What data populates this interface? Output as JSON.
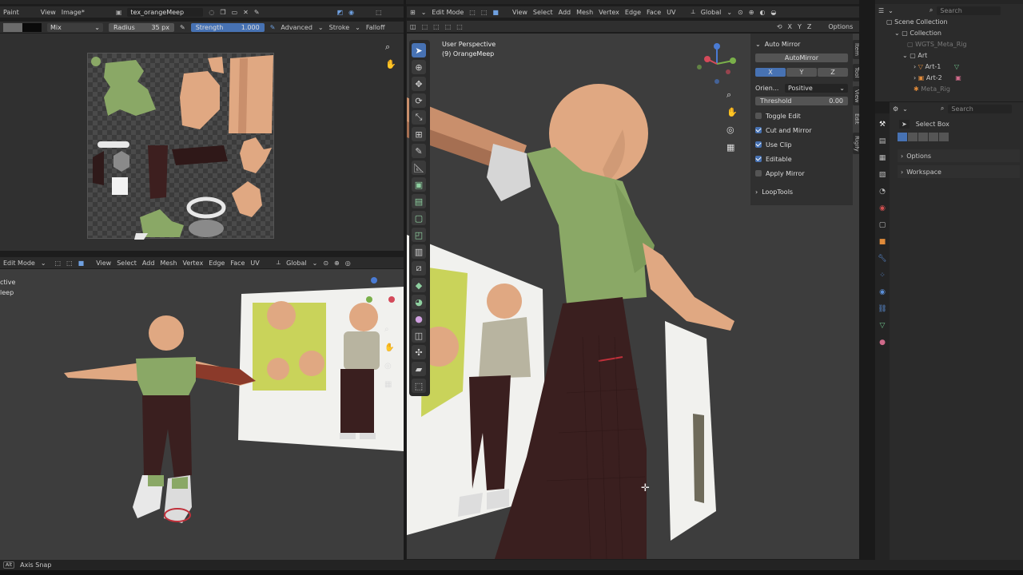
{
  "top_left_header": {
    "mode": "Paint",
    "view": "View",
    "image_menu": "Image*",
    "texture_name": "tex_orangeMeep"
  },
  "paint_tool_settings": {
    "blend_mode": "Mix",
    "radius_label": "Radius",
    "radius_value": "35 px",
    "strength_label": "Strength",
    "strength_value": "1.000",
    "advanced": "Advanced",
    "stroke": "Stroke",
    "falloff": "Falloff"
  },
  "left_viewport_header": {
    "mode": "Edit Mode",
    "menus": [
      "View",
      "Select",
      "Add",
      "Mesh",
      "Vertex",
      "Edge",
      "Face",
      "UV"
    ],
    "transform": "Global"
  },
  "left_viewport_overlay": {
    "line1": "ctive",
    "line2": "leep"
  },
  "main_viewport_header": {
    "mode": "Edit Mode",
    "menus": [
      "View",
      "Select",
      "Add",
      "Mesh",
      "Vertex",
      "Edge",
      "Face",
      "UV"
    ],
    "transform": "Global",
    "axes": [
      "X",
      "Y",
      "Z"
    ],
    "options": "Options"
  },
  "main_viewport_overlay": {
    "perspective": "User Perspective",
    "object": "(9) OrangeMeep"
  },
  "auto_mirror_panel": {
    "title": "Auto Mirror",
    "button": "AutoMirror",
    "axes": [
      "X",
      "Y",
      "Z"
    ],
    "orientation_label": "Orien...",
    "orientation_value": "Positive",
    "threshold_label": "Threshold",
    "threshold_value": "0.00",
    "toggle_edit": "Toggle Edit",
    "cut_and_mirror": "Cut and Mirror",
    "use_clip": "Use Clip",
    "editable": "Editable",
    "apply_mirror": "Apply Mirror",
    "looptools": "LoopTools"
  },
  "sidebar_tabs": [
    "Item",
    "Tool",
    "View",
    "Edit",
    "Rigify"
  ],
  "outliner": {
    "search_placeholder": "Search",
    "scene_collection": "Scene Collection",
    "collection": "Collection",
    "items": [
      "WGTS_Meta_Rig",
      "Art",
      "Art-1",
      "Art-2",
      "Meta_Rig"
    ]
  },
  "properties": {
    "search_placeholder": "Search",
    "active_tool": "Select Box",
    "options": "Options",
    "workspace": "Workspace"
  },
  "status_bar": {
    "axis_snap": "Axis Snap"
  },
  "colors": {
    "accent": "#4772b3",
    "panel": "#2b2b2b",
    "viewport": "#3d3d3d",
    "shirt_green": "#8aa866",
    "skin": "#e0a882",
    "pants": "#3a1f1f",
    "reference_yellow": "#c9d35a"
  }
}
